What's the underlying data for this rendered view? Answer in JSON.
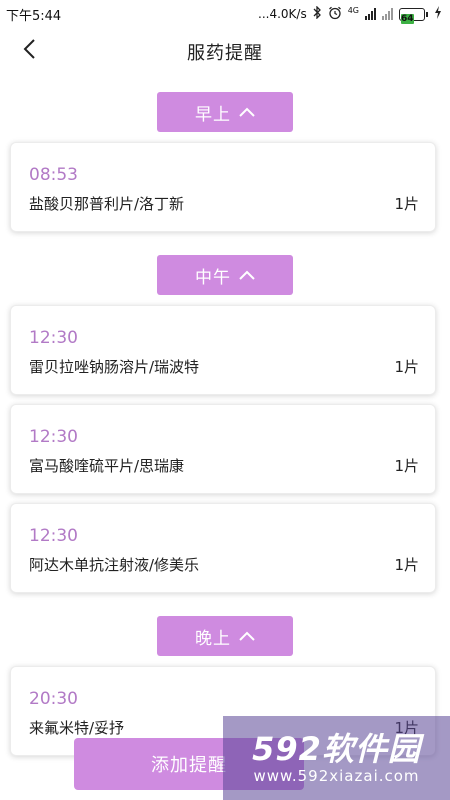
{
  "status_bar": {
    "time": "下午5:44",
    "network_speed": "...4.0K/s",
    "network_type": "4G",
    "battery": "64"
  },
  "header": {
    "title": "服药提醒"
  },
  "sections": [
    {
      "label": "早上"
    },
    {
      "label": "中午"
    },
    {
      "label": "晚上"
    }
  ],
  "reminders": [
    {
      "time": "08:53",
      "drug": "盐酸贝那普利片/洛丁新",
      "dose": "1片"
    },
    {
      "time": "12:30",
      "drug": "雷贝拉唑钠肠溶片/瑞波特",
      "dose": "1片"
    },
    {
      "time": "12:30",
      "drug": "富马酸喹硫平片/思瑞康",
      "dose": "1片"
    },
    {
      "time": "12:30",
      "drug": "阿达木单抗注射液/修美乐",
      "dose": "1片"
    },
    {
      "time": "20:30",
      "drug": "来氟米特/妥抒",
      "dose": "1片"
    }
  ],
  "add_button": {
    "label": "添加提醒"
  },
  "watermark": {
    "logo": "592软件园",
    "url": "www.592xiazai.com"
  },
  "colors": {
    "accent": "#cf8be0",
    "time_text": "#b27ac6"
  }
}
